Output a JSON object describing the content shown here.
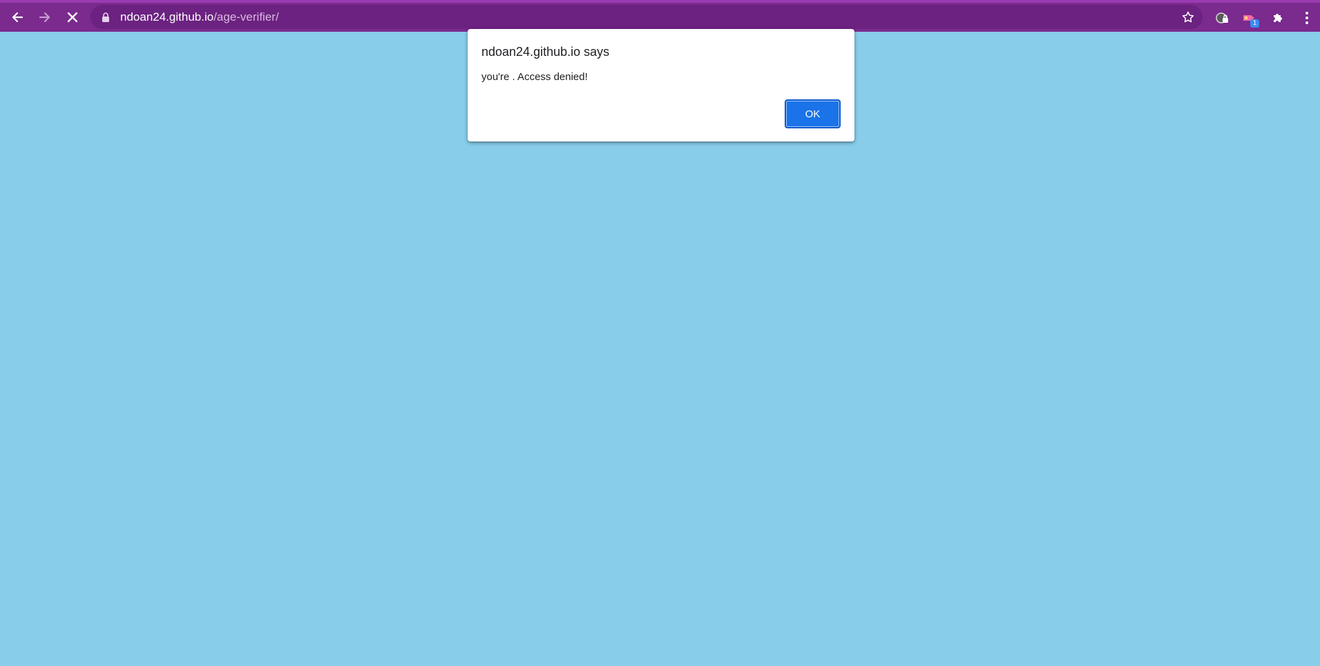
{
  "browser": {
    "url_host": "ndoan24.github.io",
    "url_path": "/age-verifier/",
    "toolbar_color": "#7B2A8E",
    "omnibox_color": "#6B2280",
    "icons": {
      "back": "arrow-left-icon",
      "forward": "arrow-right-icon",
      "stop": "close-icon",
      "lock": "lock-icon",
      "bookmark": "star-icon",
      "extension_one": "incognito-lock-icon",
      "extension_two": "tag-icon",
      "extensions": "puzzle-icon",
      "menu": "kebab-menu-icon"
    },
    "extension_badge": "1"
  },
  "page": {
    "background_color": "#88CDEA"
  },
  "alert": {
    "title": "ndoan24.github.io says",
    "message": "you're . Access denied!",
    "ok_label": "OK",
    "button_color": "#1A73E8"
  }
}
